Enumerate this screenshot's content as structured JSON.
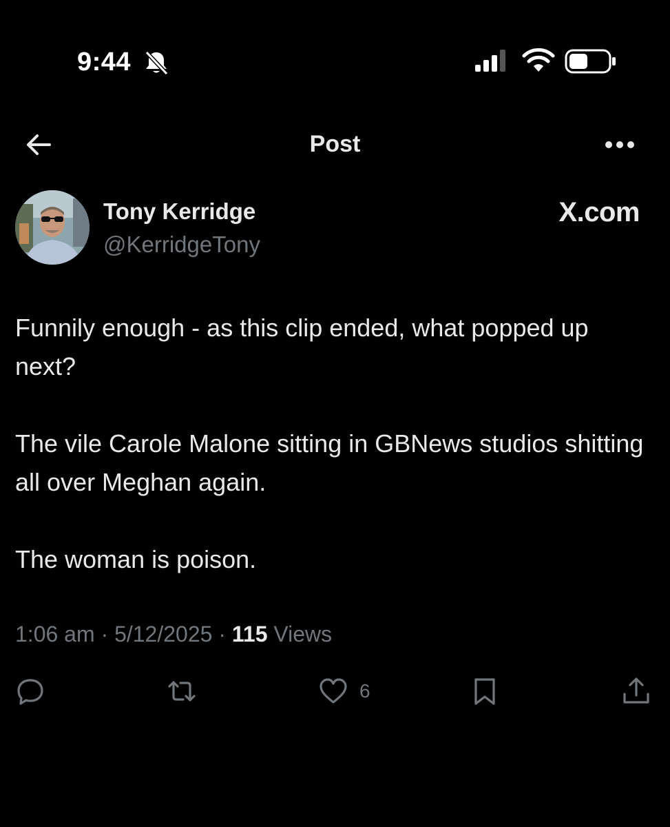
{
  "status_bar": {
    "time": "9:44",
    "icons": [
      "bell-slash-icon",
      "signal-icon",
      "wifi-icon",
      "battery-icon"
    ]
  },
  "header": {
    "title": "Post",
    "icons": [
      "back-arrow-icon",
      "more-icon"
    ]
  },
  "post": {
    "author": {
      "name": "Tony Kerridge",
      "handle": "@KerridgeTony"
    },
    "watermark": "X.com",
    "paragraphs": [
      "Funnily enough - as this clip ended, what popped up next?",
      "The vile Carole Malone sitting in GBNews studios shitting all over Meghan again.",
      "The woman is poison."
    ],
    "meta": {
      "time": "1:06 am",
      "separator": "·",
      "date": "5/12/2025",
      "views_count": "115",
      "views_label": "Views"
    },
    "actions": {
      "reply_count": "",
      "repost_count": "",
      "like_count": "6",
      "icons": [
        "reply-icon",
        "repost-icon",
        "like-icon",
        "bookmark-icon",
        "share-icon"
      ]
    }
  },
  "colors": {
    "background": "#000000",
    "text_primary": "#e7e9ea",
    "text_secondary": "#71767b"
  }
}
